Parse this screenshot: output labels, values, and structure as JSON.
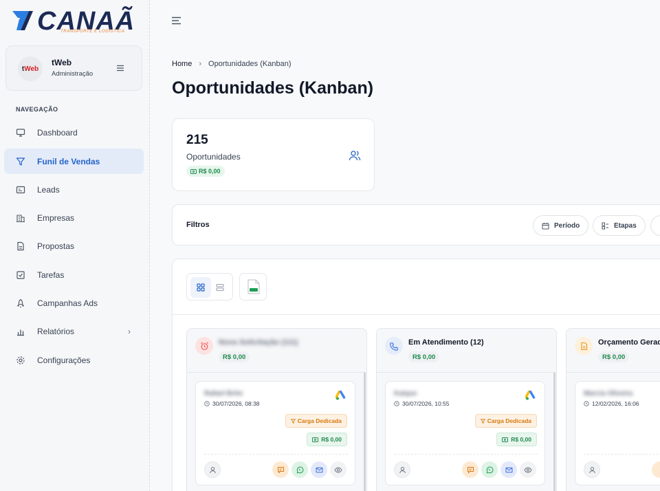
{
  "brand": {
    "logo_text": "CANAÃ",
    "logo_sub": "TRANSPORTE E LOGÍSTICA"
  },
  "profile": {
    "avatar_text_a": "t",
    "avatar_text_b": "Web",
    "name": "tWeb",
    "role": "Administração"
  },
  "nav": {
    "section_label": "NAVEGAÇÃO",
    "items": [
      {
        "label": "Dashboard",
        "icon": "monitor-icon"
      },
      {
        "label": "Funil de Vendas",
        "icon": "funnel-icon",
        "active": true
      },
      {
        "label": "Leads",
        "icon": "id-card-icon"
      },
      {
        "label": "Empresas",
        "icon": "building-icon"
      },
      {
        "label": "Propostas",
        "icon": "document-icon"
      },
      {
        "label": "Tarefas",
        "icon": "checkbox-icon"
      },
      {
        "label": "Campanhas Ads",
        "icon": "rocket-icon"
      },
      {
        "label": "Relatórios",
        "icon": "bar-chart-icon",
        "chevron": "›"
      },
      {
        "label": "Configurações",
        "icon": "gear-icon"
      }
    ]
  },
  "breadcrumb": {
    "home": "Home",
    "separator": "›",
    "current": "Oportunidades (Kanban)"
  },
  "page": {
    "title": "Oportunidades (Kanban)"
  },
  "stats": {
    "count": "215",
    "label": "Oportunidades",
    "value": "R$ 0,00"
  },
  "filters": {
    "title": "Filtros",
    "buttons": [
      "Período",
      "Etapas"
    ]
  },
  "columns": [
    {
      "title": "Nova Solicitação (111)",
      "blurred": true,
      "value": "R$ 0,00",
      "color": "#f25c5c",
      "bg": "#fde2e2",
      "icon": "alarm-icon",
      "card": {
        "name": "Rafael Brito",
        "date": "30/07/2026, 08:38",
        "tag": "Carga Dedicada",
        "value": "R$ 0,00"
      }
    },
    {
      "title": "Em Atendimento (12)",
      "blurred": false,
      "value": "R$ 0,00",
      "color": "#3b6fd8",
      "bg": "#e5edfb",
      "icon": "phone-icon",
      "card": {
        "name": "Kaique",
        "date": "30/07/2026, 10:55",
        "tag": "Carga Dedicada",
        "value": "R$ 0,00"
      }
    },
    {
      "title": "Orçamento Gerado",
      "blurred": false,
      "value": "R$ 0,00",
      "color": "#e3961b",
      "bg": "#fdf0dc",
      "icon": "file-icon",
      "card": {
        "name": "Marcia Oliveira",
        "date": "12/02/2026, 16:06"
      }
    }
  ],
  "colors": {
    "accent": "#2563c9",
    "success": "#1f8a4c",
    "warning": "#d9770b"
  }
}
